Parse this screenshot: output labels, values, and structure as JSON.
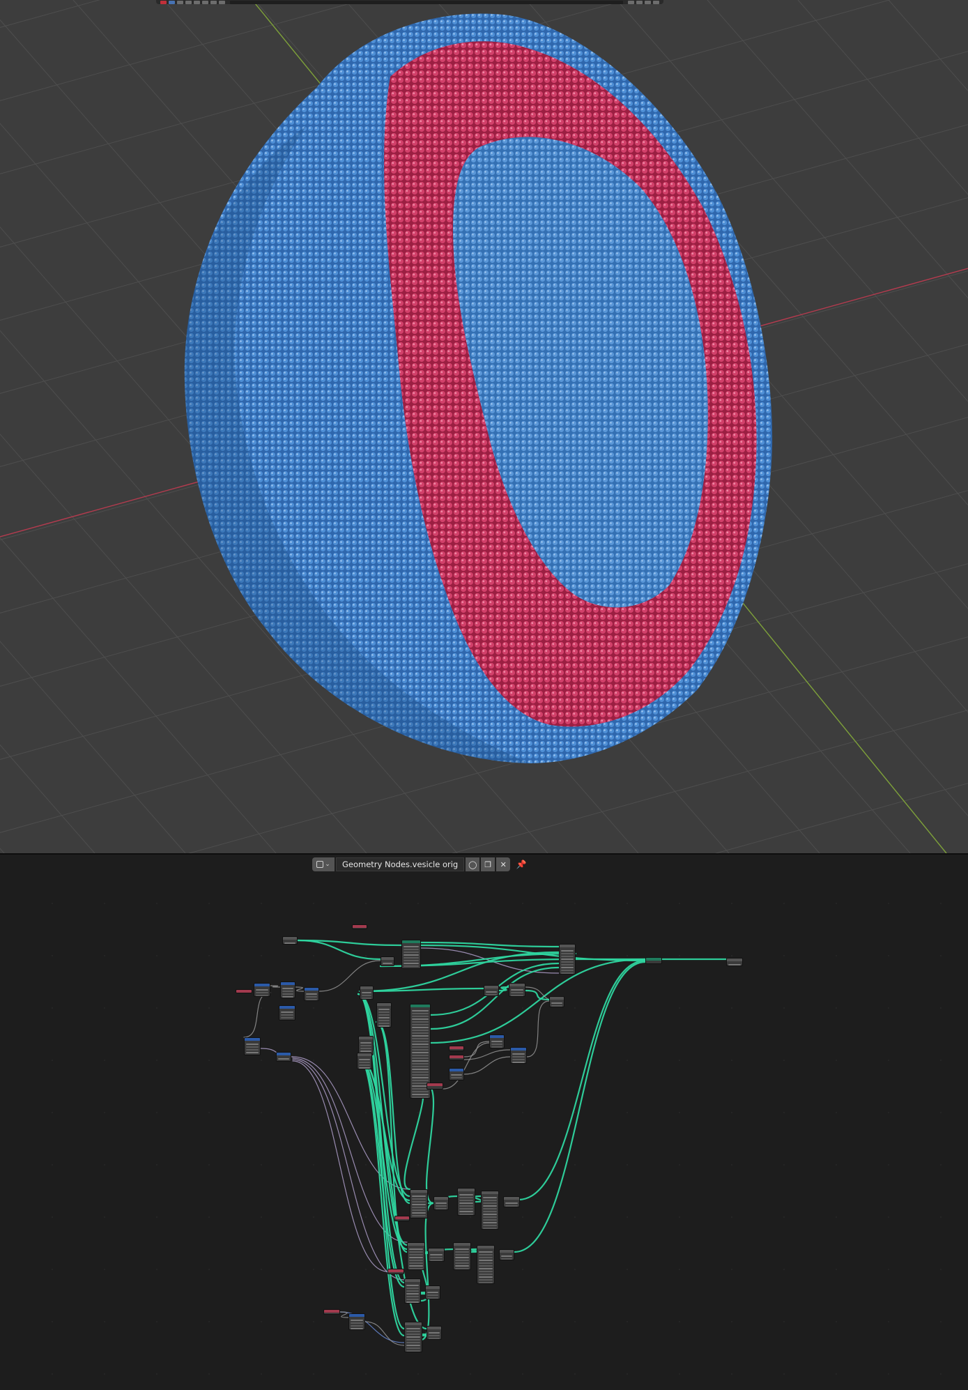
{
  "viewport_3d": {
    "header_buttons": 14,
    "colors": {
      "background": "#3d3d3d",
      "grid": "#505050",
      "x_axis": "#b63b4f",
      "y_axis": "#7ea13a",
      "outer_shell": "#3f7cc4",
      "middle_layer": "#c7345a",
      "inner_shell": "#4581c7"
    }
  },
  "node_editor": {
    "editor_type_icon": "node-tree-icon",
    "node_group_name": "Geometry Nodes.vesicle orig",
    "fake_user_icon": "shield-icon",
    "duplicate_icon": "duplicate-icon",
    "close_icon": "close-icon",
    "pin_icon": "pin-icon",
    "colors": {
      "background": "#1d1d1d",
      "geometry_link": "#2fd6a0",
      "vector_link": "#b9a7d6",
      "float_link": "#9e9e9e",
      "blue_link": "#6c8ee0"
    }
  }
}
